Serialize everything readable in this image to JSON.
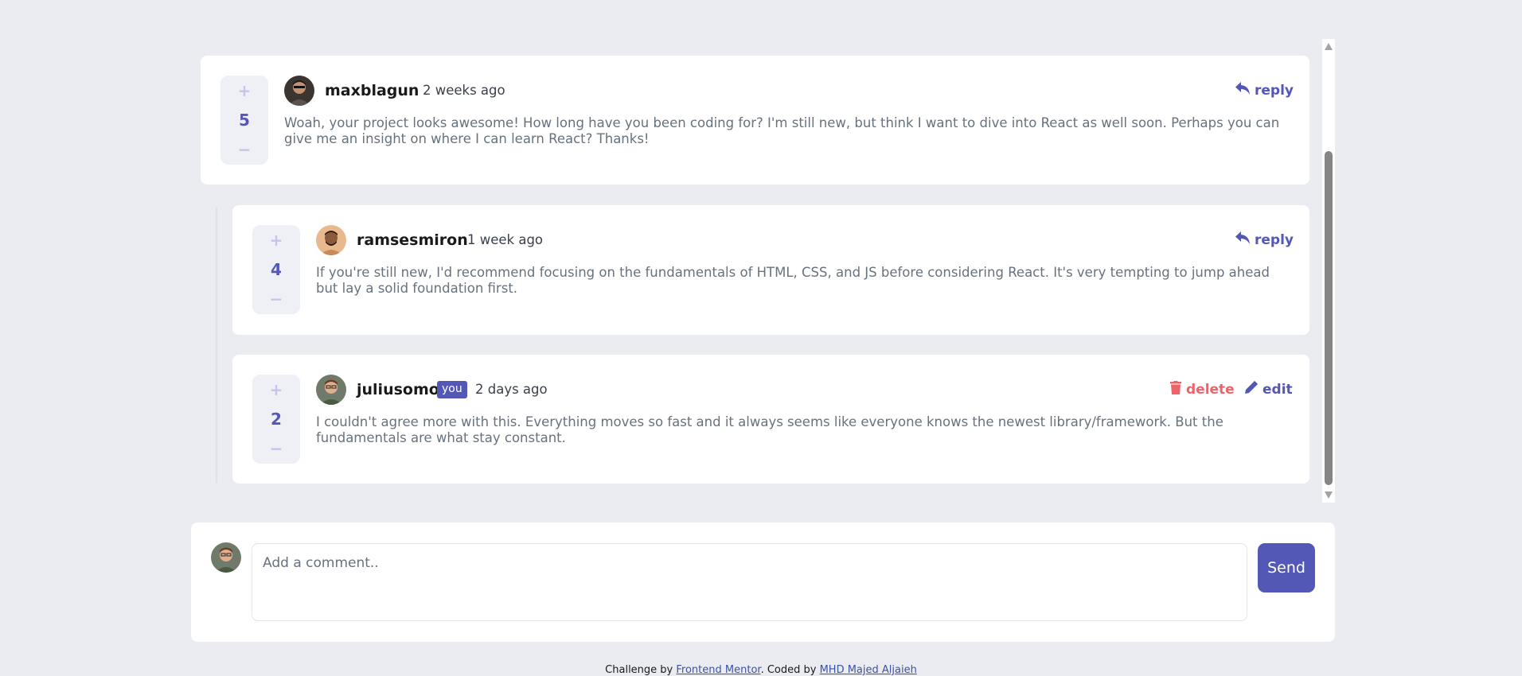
{
  "comments": [
    {
      "username": "maxblagun",
      "time": "2 weeks ago",
      "score": "5",
      "text": "Woah, your project looks awesome! How long have you been coding for? I'm still new, but think I want to dive into React as well soon. Perhaps you can give me an insight on where I can learn React? Thanks!",
      "action": "reply"
    },
    {
      "username": "ramsesmiron",
      "time": "1 week ago",
      "score": "4",
      "text": "If you're still new, I'd recommend focusing on the fundamentals of HTML, CSS, and JS before considering React. It's very tempting to jump ahead but lay a solid foundation first.",
      "action": "reply"
    },
    {
      "username": "juliusomo",
      "badge": "you",
      "time": "2 days ago",
      "score": "2",
      "text": "I couldn't agree more with this. Everything moves so fast and it always seems like everyone knows the newest library/framework. But the fundamentals are what stay constant.",
      "delete_label": "delete",
      "edit_label": "edit"
    }
  ],
  "vote": {
    "plus": "+",
    "minus": "−"
  },
  "composer": {
    "placeholder": "Add a comment..",
    "send_label": "Send"
  },
  "footer": {
    "challenge_prefix": "Challenge by",
    "challenge_link": "Frontend Mentor",
    "coded_prefix": ". Coded by",
    "coded_link": "MHD Majed Aljaieh"
  },
  "colors": {
    "accent": "#5357b6",
    "danger": "#ed6468",
    "background": "#eaecf1"
  },
  "icons": {
    "reply": "reply-arrow-icon",
    "delete": "trash-icon",
    "edit": "pencil-icon"
  }
}
